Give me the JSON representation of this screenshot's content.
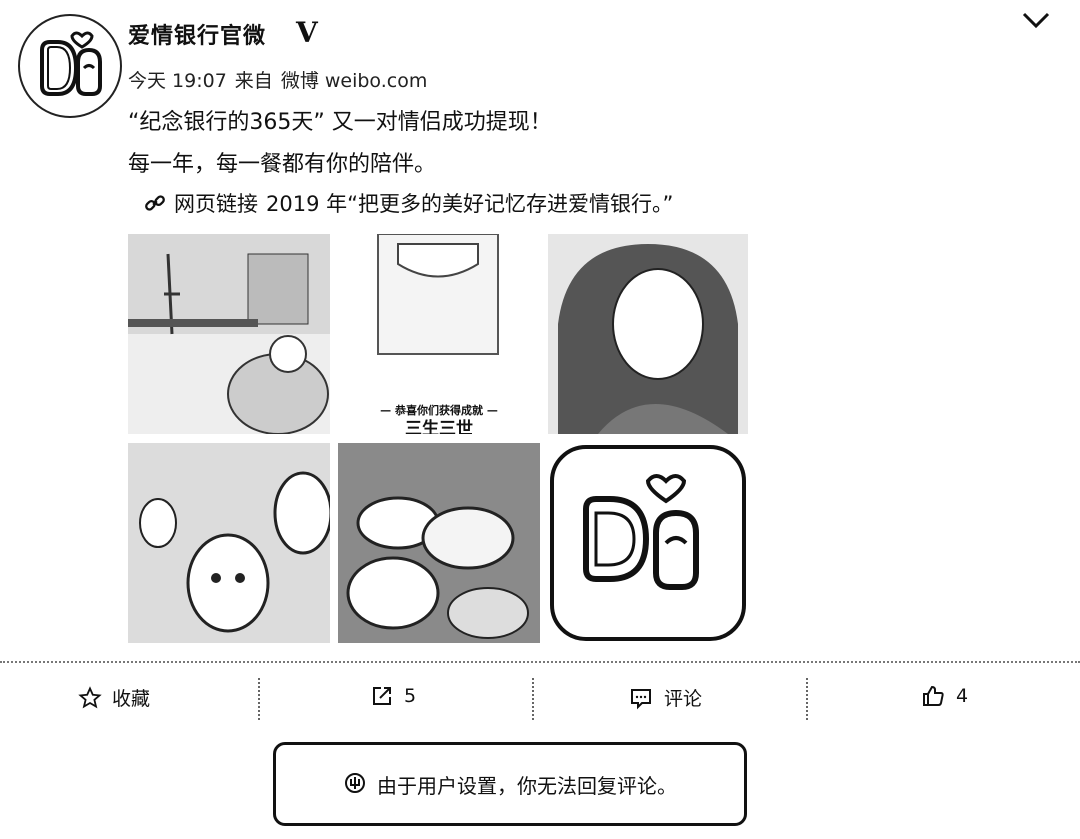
{
  "post": {
    "author": "爱情银行官微",
    "verified_mark": "V",
    "time": "今天 19:07",
    "source_prefix": "来自",
    "source": "微博 weibo.com",
    "line1": "“纪念银行的365天” 又一对情侣成功提现！",
    "line2": "每一年，每一餐都有你的陪伴。",
    "link_label": "网页链接",
    "link_text": "2019 年“把更多的美好记忆存进爱情银行。”"
  },
  "images": {
    "tile2_caption_small": "— 恭喜你们获得成就 —",
    "tile2_caption_big": "三生三世"
  },
  "actions": {
    "favorite_label": "收藏",
    "repost_count": "5",
    "comment_label": "评论",
    "like_count": "4"
  },
  "notice": {
    "text": "由于用户设置，你无法回复评论。"
  },
  "icons": {
    "chevron": "chevron-down-icon",
    "link": "link-icon",
    "star": "star-icon",
    "repost": "repost-icon",
    "comment": "comment-icon",
    "like": "thumbs-up-icon",
    "info": "info-icon"
  }
}
